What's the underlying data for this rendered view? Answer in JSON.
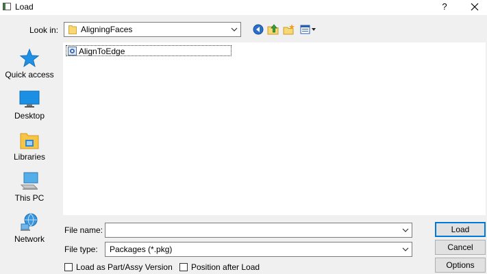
{
  "window": {
    "title": "Load",
    "help_label": "?"
  },
  "look_in": {
    "label": "Look in:",
    "value": "AligningFaces"
  },
  "toolbar": {
    "icons": [
      "back-icon",
      "up-folder-icon",
      "new-folder-icon",
      "views-icon"
    ]
  },
  "places": [
    {
      "label": "Quick access",
      "icon": "star-icon"
    },
    {
      "label": "Desktop",
      "icon": "desktop-icon"
    },
    {
      "label": "Libraries",
      "icon": "libraries-icon"
    },
    {
      "label": "This PC",
      "icon": "computer-icon"
    },
    {
      "label": "Network",
      "icon": "network-icon"
    }
  ],
  "files": [
    {
      "name": "AlignToEdge",
      "icon": "package-icon"
    }
  ],
  "file_name": {
    "label": "File name:",
    "value": ""
  },
  "file_type": {
    "label": "File type:",
    "value": "Packages (*.pkg)"
  },
  "buttons": {
    "load": "Load",
    "cancel": "Cancel",
    "options": "Options"
  },
  "checkboxes": [
    {
      "label": "Load as Part/Assy Version",
      "checked": false
    },
    {
      "label": "Position after Load",
      "checked": false
    }
  ],
  "colors": {
    "accent": "#0078d7",
    "folder": "#f8d775"
  }
}
